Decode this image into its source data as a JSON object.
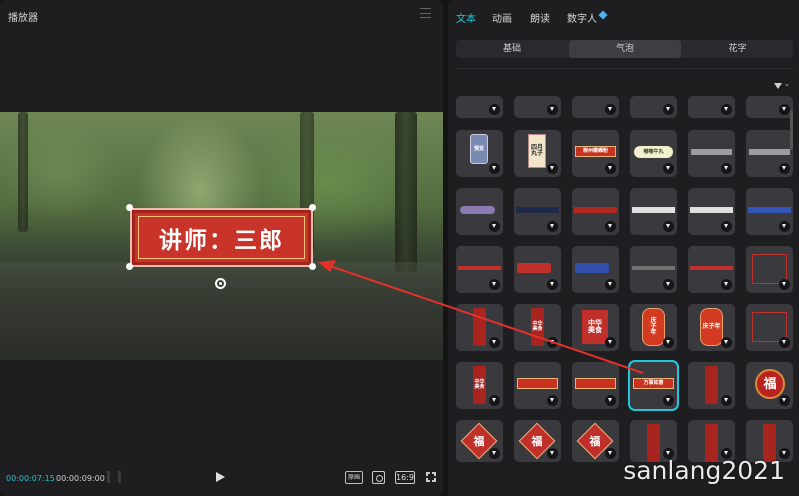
{
  "player": {
    "title": "播放器",
    "subtitle_text": "讲师：三郎",
    "time_current": "00:00:07:15",
    "time_total": "00:00:09:00",
    "ratio_label": "原画",
    "aspect_label": "16:9"
  },
  "panel": {
    "tabs": [
      {
        "label": "文本",
        "active": true
      },
      {
        "label": "动画",
        "active": false
      },
      {
        "label": "朗读",
        "active": false
      },
      {
        "label": "数字人",
        "active": false
      }
    ],
    "categories": [
      {
        "label": "基础",
        "active": false
      },
      {
        "label": "气泡",
        "active": true
      },
      {
        "label": "花字",
        "active": false
      }
    ],
    "tiles": [
      {
        "row": 1,
        "col": 1,
        "text": "预览",
        "style": "pill"
      },
      {
        "row": 1,
        "col": 2,
        "text": "四月\n丸子",
        "style": "poster"
      },
      {
        "row": 1,
        "col": 3,
        "text": "柳州螺蛳粉",
        "style": "redbar"
      },
      {
        "row": 1,
        "col": 4,
        "text": "嘟嘟牛丸",
        "style": "cream"
      },
      {
        "row": 1,
        "col": 5,
        "text": "",
        "style": "graybar"
      },
      {
        "row": 1,
        "col": 6,
        "text": "",
        "style": "graybar"
      },
      {
        "row": 2,
        "col": 1,
        "text": "",
        "style": "purplebar"
      },
      {
        "row": 2,
        "col": 2,
        "text": "",
        "style": "darkbar"
      },
      {
        "row": 2,
        "col": 3,
        "text": "",
        "style": "redstrip"
      },
      {
        "row": 2,
        "col": 4,
        "text": "",
        "style": "whitestrip"
      },
      {
        "row": 2,
        "col": 5,
        "text": "",
        "style": "whitestrip"
      },
      {
        "row": 2,
        "col": 6,
        "text": "",
        "style": "bluestrip"
      },
      {
        "row": 3,
        "col": 1,
        "text": "",
        "style": "redline"
      },
      {
        "row": 3,
        "col": 2,
        "text": "",
        "style": "redtag"
      },
      {
        "row": 3,
        "col": 3,
        "text": "",
        "style": "bluetag"
      },
      {
        "row": 3,
        "col": 4,
        "text": "",
        "style": "grayline"
      },
      {
        "row": 3,
        "col": 5,
        "text": "",
        "style": "redline"
      },
      {
        "row": 3,
        "col": 6,
        "text": "",
        "style": "redframe"
      },
      {
        "row": 4,
        "col": 1,
        "text": "",
        "style": "vertical"
      },
      {
        "row": 4,
        "col": 2,
        "text": "中华\n美食",
        "style": "vertical"
      },
      {
        "row": 4,
        "col": 3,
        "text": "中华\n美食",
        "style": "redcard"
      },
      {
        "row": 4,
        "col": 4,
        "text": "庆\n子\n年",
        "style": "redoval"
      },
      {
        "row": 4,
        "col": 5,
        "text": "庆子年",
        "style": "redoval"
      },
      {
        "row": 4,
        "col": 6,
        "text": "",
        "style": "redframe"
      },
      {
        "row": 5,
        "col": 1,
        "text": "中华\n美食",
        "style": "vertical"
      },
      {
        "row": 5,
        "col": 2,
        "text": "",
        "style": "redbar"
      },
      {
        "row": 5,
        "col": 3,
        "text": "",
        "style": "redbar"
      },
      {
        "row": 5,
        "col": 4,
        "text": "万事如意",
        "style": "redbar",
        "selected": true
      },
      {
        "row": 5,
        "col": 5,
        "text": "",
        "style": "vertical"
      },
      {
        "row": 5,
        "col": 6,
        "text": "福",
        "style": "circle"
      },
      {
        "row": 6,
        "col": 1,
        "text": "福",
        "style": "diamond"
      },
      {
        "row": 6,
        "col": 2,
        "text": "福",
        "style": "diamond"
      },
      {
        "row": 6,
        "col": 3,
        "text": "福",
        "style": "diamond"
      },
      {
        "row": 6,
        "col": 4,
        "text": "",
        "style": "vertical"
      },
      {
        "row": 6,
        "col": 5,
        "text": "",
        "style": "vertical"
      },
      {
        "row": 6,
        "col": 6,
        "text": "",
        "style": "vertical"
      }
    ]
  },
  "watermark": "sanlang2021",
  "colors": {
    "accent": "#22c8dd",
    "arrow": "#e5302a",
    "bubble": "#c9342a"
  }
}
